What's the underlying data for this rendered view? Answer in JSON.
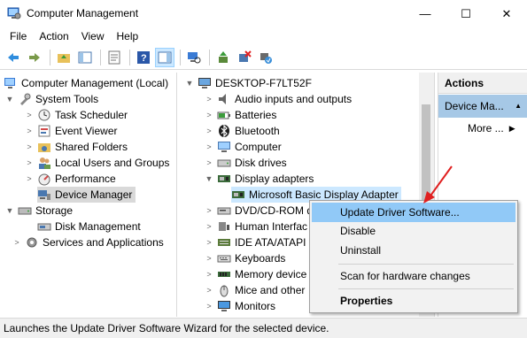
{
  "window": {
    "title": "Computer Management",
    "minimize": "—",
    "maximize": "☐",
    "close": "✕"
  },
  "menu": [
    "File",
    "Action",
    "View",
    "Help"
  ],
  "left_tree": {
    "root": "Computer Management (Local)",
    "system_tools": "System Tools",
    "task_scheduler": "Task Scheduler",
    "event_viewer": "Event Viewer",
    "shared_folders": "Shared Folders",
    "local_users": "Local Users and Groups",
    "performance": "Performance",
    "device_manager": "Device Manager",
    "storage": "Storage",
    "disk_management": "Disk Management",
    "services": "Services and Applications"
  },
  "device_tree": {
    "computer_name": "DESKTOP-F7LT52F",
    "audio": "Audio inputs and outputs",
    "batteries": "Batteries",
    "bluetooth": "Bluetooth",
    "computer": "Computer",
    "disk_drives": "Disk drives",
    "display_adapters": "Display adapters",
    "display_child": "Microsoft Basic Display Adapter",
    "dvd": "DVD/CD-ROM d",
    "hid": "Human Interfac",
    "ide": "IDE ATA/ATAPI c",
    "keyboards": "Keyboards",
    "memory": "Memory device",
    "mice": "Mice and other",
    "monitors": "Monitors"
  },
  "actions": {
    "header": "Actions",
    "selected": "Device Ma...",
    "selected_arrow": "▲",
    "more": "More ...",
    "more_arrow": "▶"
  },
  "context_menu": {
    "update": "Update Driver Software...",
    "disable": "Disable",
    "uninstall": "Uninstall",
    "scan": "Scan for hardware changes",
    "properties": "Properties"
  },
  "status": "Launches the Update Driver Software Wizard for the selected device.",
  "colors": {
    "selection_blue": "#cce8ff",
    "menu_highlight": "#91c9f7",
    "annotation_arrow": "#e02020"
  }
}
